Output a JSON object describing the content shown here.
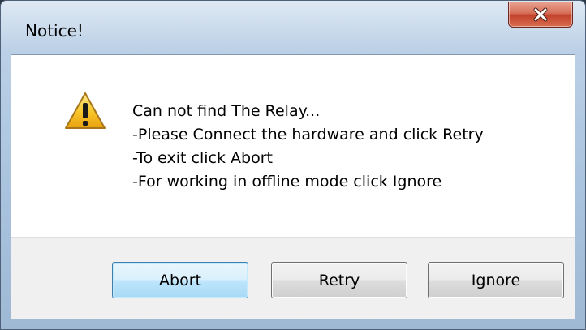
{
  "window": {
    "title": "Notice!",
    "close_icon": "close-x-icon"
  },
  "message": {
    "icon": "warning-triangle-icon",
    "lines": [
      "Can not find The Relay...",
      "-Please Connect the hardware and click Retry",
      "-To exit click Abort",
      "-For working in offline mode click Ignore"
    ]
  },
  "buttons": {
    "abort": "Abort",
    "retry": "Retry",
    "ignore": "Ignore"
  },
  "colors": {
    "frame": "#b4cbe3",
    "close_button": "#c2432b",
    "default_button": "#bee6fd",
    "warning": "#f7c52a"
  }
}
